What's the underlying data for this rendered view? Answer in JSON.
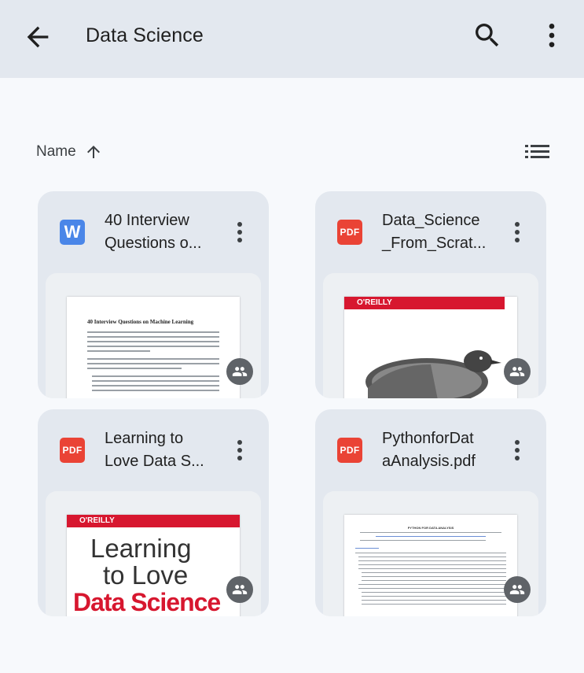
{
  "appbar": {
    "title": "Data Science",
    "back_icon": "arrow-back-icon",
    "search_icon": "search-icon",
    "more_icon": "more-vert-icon",
    "background": "#e3e8ef"
  },
  "sort": {
    "label": "Name",
    "direction_icon": "arrow-up-icon",
    "view_toggle_icon": "list-view-icon"
  },
  "files": [
    {
      "name": "40 Interview\nQuestions o...",
      "type": "word",
      "type_label": "W",
      "shared": true,
      "thumbnail": {
        "heading": "40 Interview Questions on Machine Learning"
      }
    },
    {
      "name": "Data_Science\n_From_Scrat...",
      "type": "pdf",
      "type_label": "PDF",
      "shared": true,
      "thumbnail": {
        "publisher": "O'REILLY"
      }
    },
    {
      "name": "Learning to\nLove Data S...",
      "type": "pdf",
      "type_label": "PDF",
      "shared": true,
      "thumbnail": {
        "publisher": "O'REILLY",
        "line1": "Learning",
        "line2": "to Love",
        "line3": "Data Science"
      }
    },
    {
      "name": "PythonforDat\naAnalysis.pdf",
      "type": "pdf",
      "type_label": "PDF",
      "shared": true,
      "thumbnail": {
        "heading": "PYTHON FOR DATA ANALYSIS"
      }
    }
  ],
  "colors": {
    "pdf": "#ea4335",
    "word": "#4a86e8",
    "oreilly_red": "#d7172f",
    "card_bg": "#e3e8ef"
  }
}
